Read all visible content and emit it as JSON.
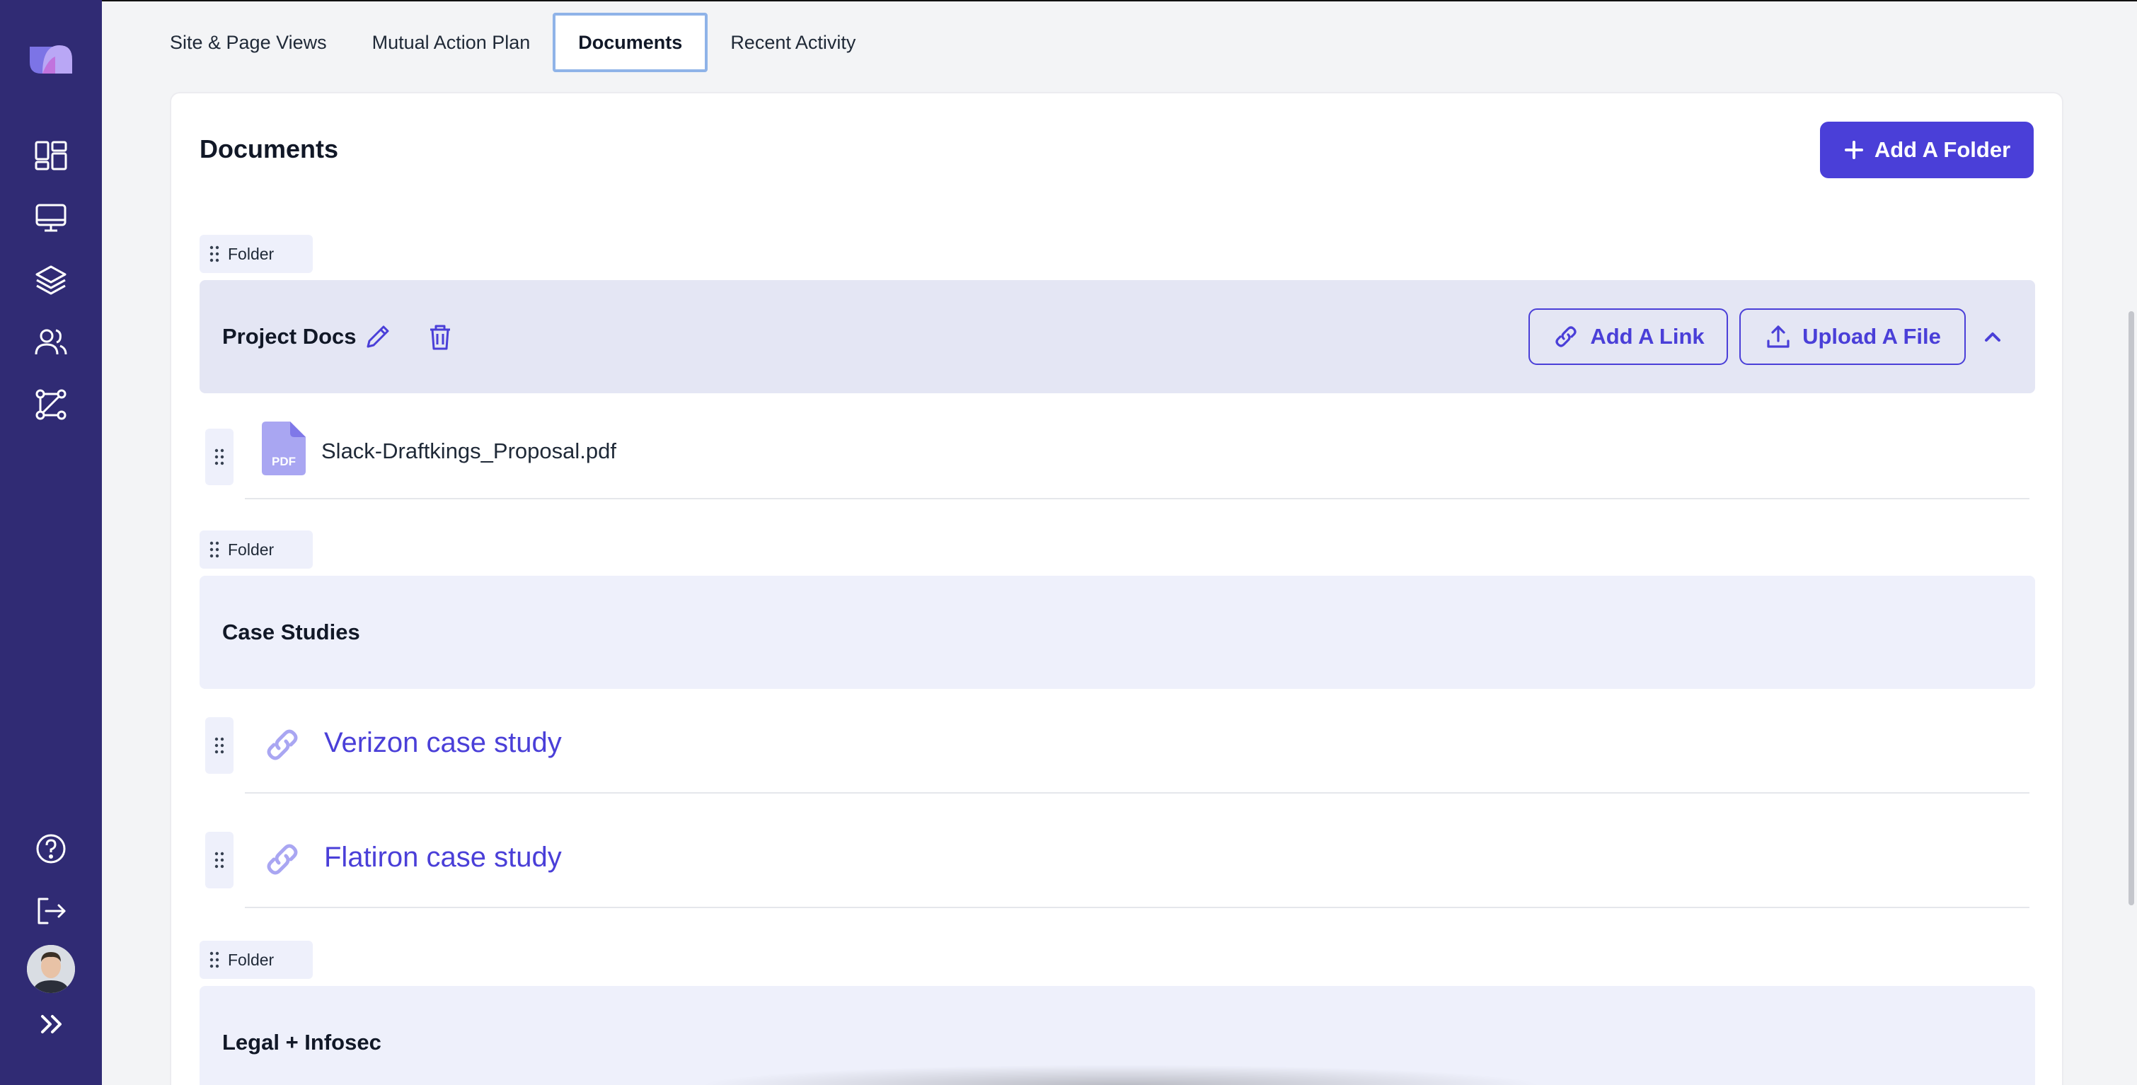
{
  "tabs": [
    {
      "label": "Site & Page Views"
    },
    {
      "label": "Mutual Action Plan"
    },
    {
      "label": "Documents",
      "active": true
    },
    {
      "label": "Recent Activity"
    }
  ],
  "page": {
    "title": "Documents",
    "add_folder_label": "Add A Folder"
  },
  "folders": [
    {
      "tag": "Folder",
      "name": "Project Docs",
      "add_link_label": "Add A Link",
      "upload_label": "Upload A File",
      "items": [
        {
          "type": "file",
          "icon": "pdf-icon",
          "icon_text": "PDF",
          "name": "Slack-Draftkings_Proposal.pdf"
        }
      ]
    },
    {
      "tag": "Folder",
      "name": "Case Studies",
      "items": [
        {
          "type": "link",
          "icon": "link-icon",
          "name": "Verizon case study"
        },
        {
          "type": "link",
          "icon": "link-icon",
          "name": "Flatiron case study"
        }
      ]
    },
    {
      "tag": "Folder",
      "name": "Legal + Infosec",
      "items": []
    }
  ],
  "sidebar": {
    "icons": [
      "logo-icon",
      "dashboard-icon",
      "monitor-icon",
      "layers-icon",
      "users-icon",
      "workflow-icon",
      "help-icon",
      "logout-icon",
      "avatar",
      "expand-icon"
    ]
  },
  "colors": {
    "sidebar": "#302b74",
    "accent": "#4a3fd8",
    "folder_bg": "#eef0fb"
  }
}
